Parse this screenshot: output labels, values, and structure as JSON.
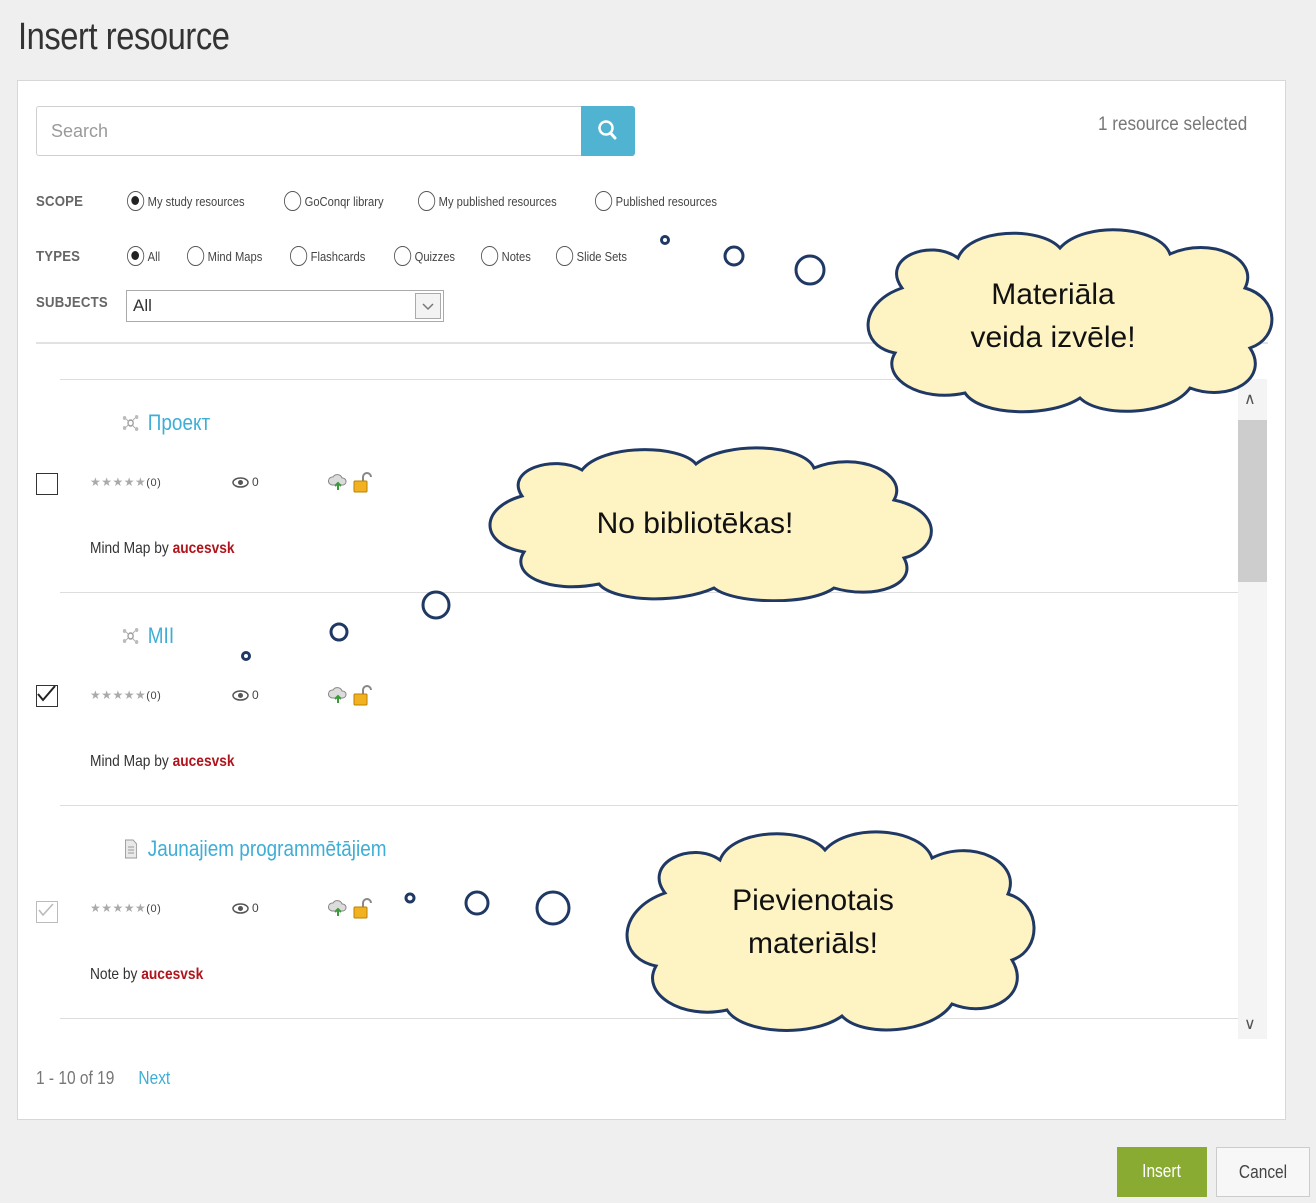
{
  "dialog": {
    "title": "Insert resource"
  },
  "search": {
    "placeholder": "Search",
    "button_icon": "search-icon"
  },
  "selection": {
    "count_text": "1 resource selected"
  },
  "filters": {
    "scope": {
      "label": "SCOPE",
      "options": [
        "My study resources",
        "GoConqr library",
        "My published resources",
        "Published resources"
      ],
      "selected": "My study resources"
    },
    "types": {
      "label": "TYPES",
      "options": [
        "All",
        "Mind Maps",
        "Flashcards",
        "Quizzes",
        "Notes",
        "Slide Sets"
      ],
      "selected": "All"
    },
    "subjects": {
      "label": "SUBJECTS",
      "value": "All"
    }
  },
  "resources": [
    {
      "title": "Проект",
      "icon": "mind-map-icon",
      "rating_count": "(0)",
      "views": "0",
      "by_text": "Mind Map by",
      "author": "aucesvsk",
      "checked": false,
      "disabled": false
    },
    {
      "title": "MII",
      "icon": "mind-map-icon",
      "rating_count": "(0)",
      "views": "0",
      "by_text": "Mind Map by",
      "author": "aucesvsk",
      "checked": true,
      "disabled": false
    },
    {
      "title": "Jaunajiem programmētājiem",
      "icon": "note-icon",
      "rating_count": "(0)",
      "views": "0",
      "by_text": "Note by",
      "author": "aucesvsk",
      "checked": true,
      "disabled": true
    }
  ],
  "pagination": {
    "range": "1 - 10 of 19",
    "next_label": "Next"
  },
  "footer": {
    "insert_label": "Insert",
    "cancel_label": "Cancel"
  },
  "annotations": {
    "cloud1": {
      "line1": "Materiāla",
      "line2": "veida izvēle!"
    },
    "cloud2": {
      "line1": "No bibliotēkas!"
    },
    "cloud3": {
      "line1": "Pievienotais",
      "line2": "materiāls!"
    }
  },
  "colors": {
    "accent": "#4fb3d1",
    "link": "#3eaed6",
    "insert": "#8aab32",
    "author": "#b0141c",
    "cloud_fill": "#fef3c3",
    "cloud_stroke": "#1f3864"
  }
}
